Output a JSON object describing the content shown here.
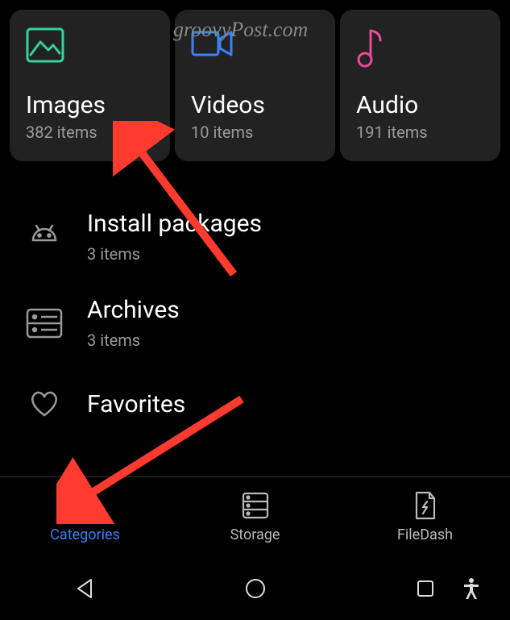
{
  "watermark": "groovyPost.com",
  "tiles": {
    "images": {
      "title": "Images",
      "count": "382 items"
    },
    "videos": {
      "title": "Videos",
      "count": "10 items"
    },
    "audio": {
      "title": "Audio",
      "count": "191 items"
    }
  },
  "list": {
    "install_packages": {
      "title": "Install packages",
      "count": "3 items"
    },
    "archives": {
      "title": "Archives",
      "count": "3 items"
    },
    "favorites": {
      "title": "Favorites",
      "count": ""
    }
  },
  "tabs": {
    "categories": "Categories",
    "storage": "Storage",
    "filedash": "FileDash"
  },
  "colors": {
    "images_icon": "#34d399",
    "videos_icon": "#3b82f6",
    "audio_icon": "#ec4899",
    "active_tab": "#3b82f6",
    "arrow": "#ff3b30"
  }
}
